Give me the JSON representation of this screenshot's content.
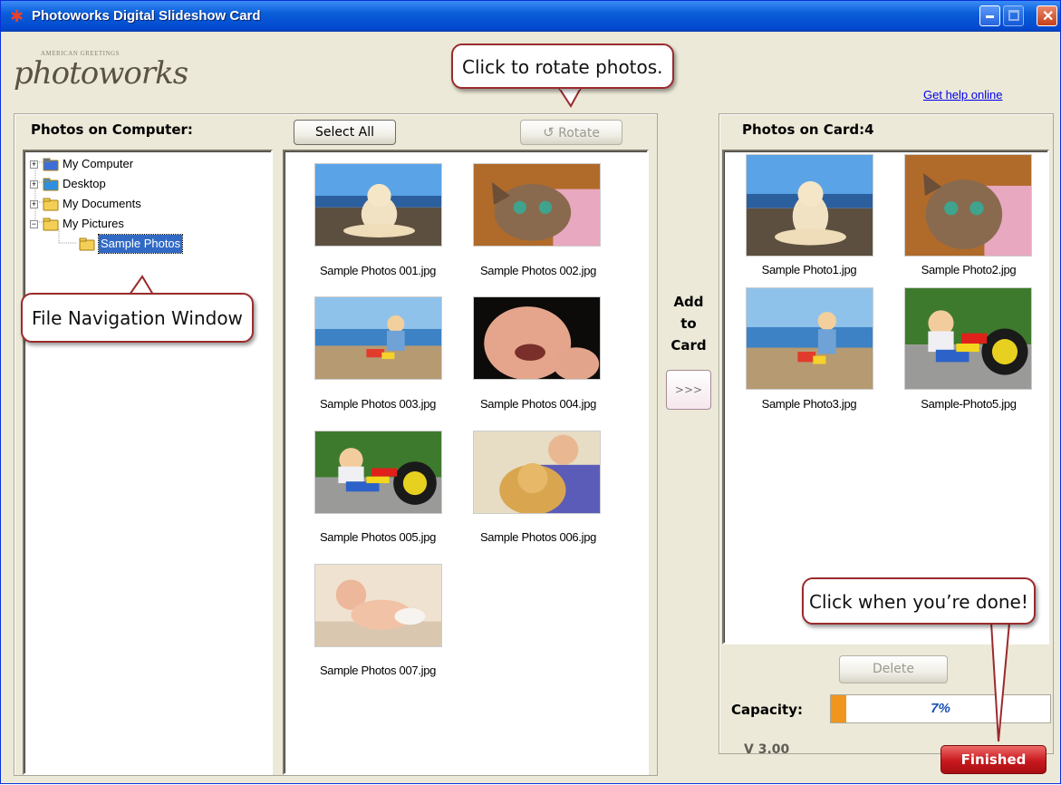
{
  "window": {
    "title": "Photoworks Digital Slideshow Card",
    "title_icon": "photoworks-star-icon"
  },
  "logo": {
    "tagline": "AMERICAN GREETINGS",
    "name": "photoworks"
  },
  "help_link": "Get help online",
  "left": {
    "heading": "Photos on Computer:",
    "select_all_label": "Select All",
    "rotate_label": "Rotate",
    "tree": [
      {
        "label": "My Computer",
        "expander": "+",
        "icon": "my-computer-icon"
      },
      {
        "label": "Desktop",
        "expander": "+",
        "icon": "desktop-icon"
      },
      {
        "label": "My Documents",
        "expander": "+",
        "icon": "folder-icon"
      },
      {
        "label": "My Pictures",
        "expander": "−",
        "icon": "pictures-folder-icon"
      },
      {
        "label": "Sample Photos",
        "expander": "",
        "icon": "open-folder-icon",
        "selected": true
      }
    ],
    "photos": [
      {
        "caption": "Sample Photos 001.jpg",
        "subject": "dog on beach"
      },
      {
        "caption": "Sample Photos 002.jpg",
        "subject": "kitten"
      },
      {
        "caption": "Sample Photos 003.jpg",
        "subject": "child on beach"
      },
      {
        "caption": "Sample Photos 004.jpg",
        "subject": "laughing baby"
      },
      {
        "caption": "Sample Photos 005.jpg",
        "subject": "child on tricycle"
      },
      {
        "caption": "Sample Photos 006.jpg",
        "subject": "boy with puppy"
      },
      {
        "caption": "Sample Photos 007.jpg",
        "subject": "crawling baby"
      }
    ]
  },
  "add": {
    "label_lines": [
      "Add",
      "to",
      "Card"
    ],
    "button_label": ">>>"
  },
  "right": {
    "heading": "Photos on Card:4",
    "photos": [
      {
        "caption": "Sample Photo1.jpg",
        "subject": "dog on beach"
      },
      {
        "caption": "Sample Photo2.jpg",
        "subject": "kitten"
      },
      {
        "caption": "Sample Photo3.jpg",
        "subject": "child on beach"
      },
      {
        "caption": "Sample-Photo5.jpg",
        "subject": "child on tricycle"
      }
    ],
    "delete_label": "Delete",
    "capacity_label": "Capacity:",
    "capacity_value": "7%",
    "capacity_fraction": 0.07
  },
  "version": "V 3.00",
  "finished_label": "Finished",
  "callouts": {
    "rotate": "Click to rotate photos.",
    "navigation": "File Navigation Window",
    "finished": "Click when you’re done!"
  },
  "colors": {
    "titlebar": "#0a5ed8",
    "selection": "#316ac5",
    "finished_button": "#c8191e",
    "callout_border": "#9a2b2d",
    "capacity_fill": "#f0961e"
  }
}
